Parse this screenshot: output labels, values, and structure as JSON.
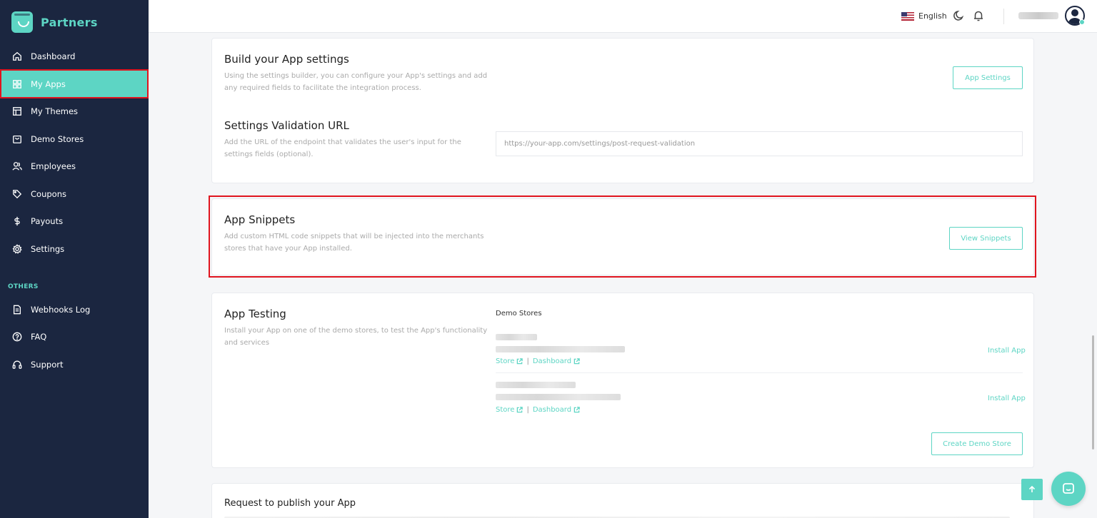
{
  "brand": {
    "name": "Partners"
  },
  "sidebar": {
    "items": [
      {
        "label": "Dashboard",
        "icon": "home-icon"
      },
      {
        "label": "My Apps",
        "icon": "grid-icon",
        "active": true
      },
      {
        "label": "My Themes",
        "icon": "layout-icon"
      },
      {
        "label": "Demo Stores",
        "icon": "store-icon"
      },
      {
        "label": "Employees",
        "icon": "users-icon"
      },
      {
        "label": "Coupons",
        "icon": "tag-icon"
      },
      {
        "label": "Payouts",
        "icon": "dollar-icon"
      },
      {
        "label": "Settings",
        "icon": "gear-icon"
      }
    ],
    "others_label": "OTHERS",
    "others": [
      {
        "label": "Webhooks Log",
        "icon": "document-icon"
      },
      {
        "label": "FAQ",
        "icon": "help-icon"
      },
      {
        "label": "Support",
        "icon": "headset-icon"
      }
    ]
  },
  "header": {
    "language": "English"
  },
  "settings_card": {
    "build_title": "Build your App settings",
    "build_desc": "Using the settings builder, you can configure your App's settings and add any required fields to facilitate the integration process.",
    "app_settings_button": "App Settings",
    "validation_title": "Settings Validation URL",
    "validation_desc": "Add the URL of the endpoint that validates the user's input for the settings fields (optional).",
    "validation_placeholder": "https://your-app.com/settings/post-request-validation"
  },
  "snippets_card": {
    "title": "App Snippets",
    "desc": "Add custom HTML code snippets that will be injected into the merchants stores that have your App installed.",
    "button": "View Snippets"
  },
  "testing_card": {
    "title": "App Testing",
    "desc": "Install your App on one of the demo stores, to test the App's functionality and services",
    "demo_stores_label": "Demo Stores",
    "stores": [
      {
        "store_link": "Store",
        "dashboard_link": "Dashboard",
        "install": "Install App"
      },
      {
        "store_link": "Store",
        "dashboard_link": "Dashboard",
        "install": "Install App"
      }
    ],
    "create_button": "Create Demo Store"
  },
  "publish_card": {
    "title": "Request to publish your App"
  },
  "colors": {
    "accent": "#5dd5c4",
    "sidebar_bg": "#1b2640",
    "highlight": "#e0141e"
  }
}
